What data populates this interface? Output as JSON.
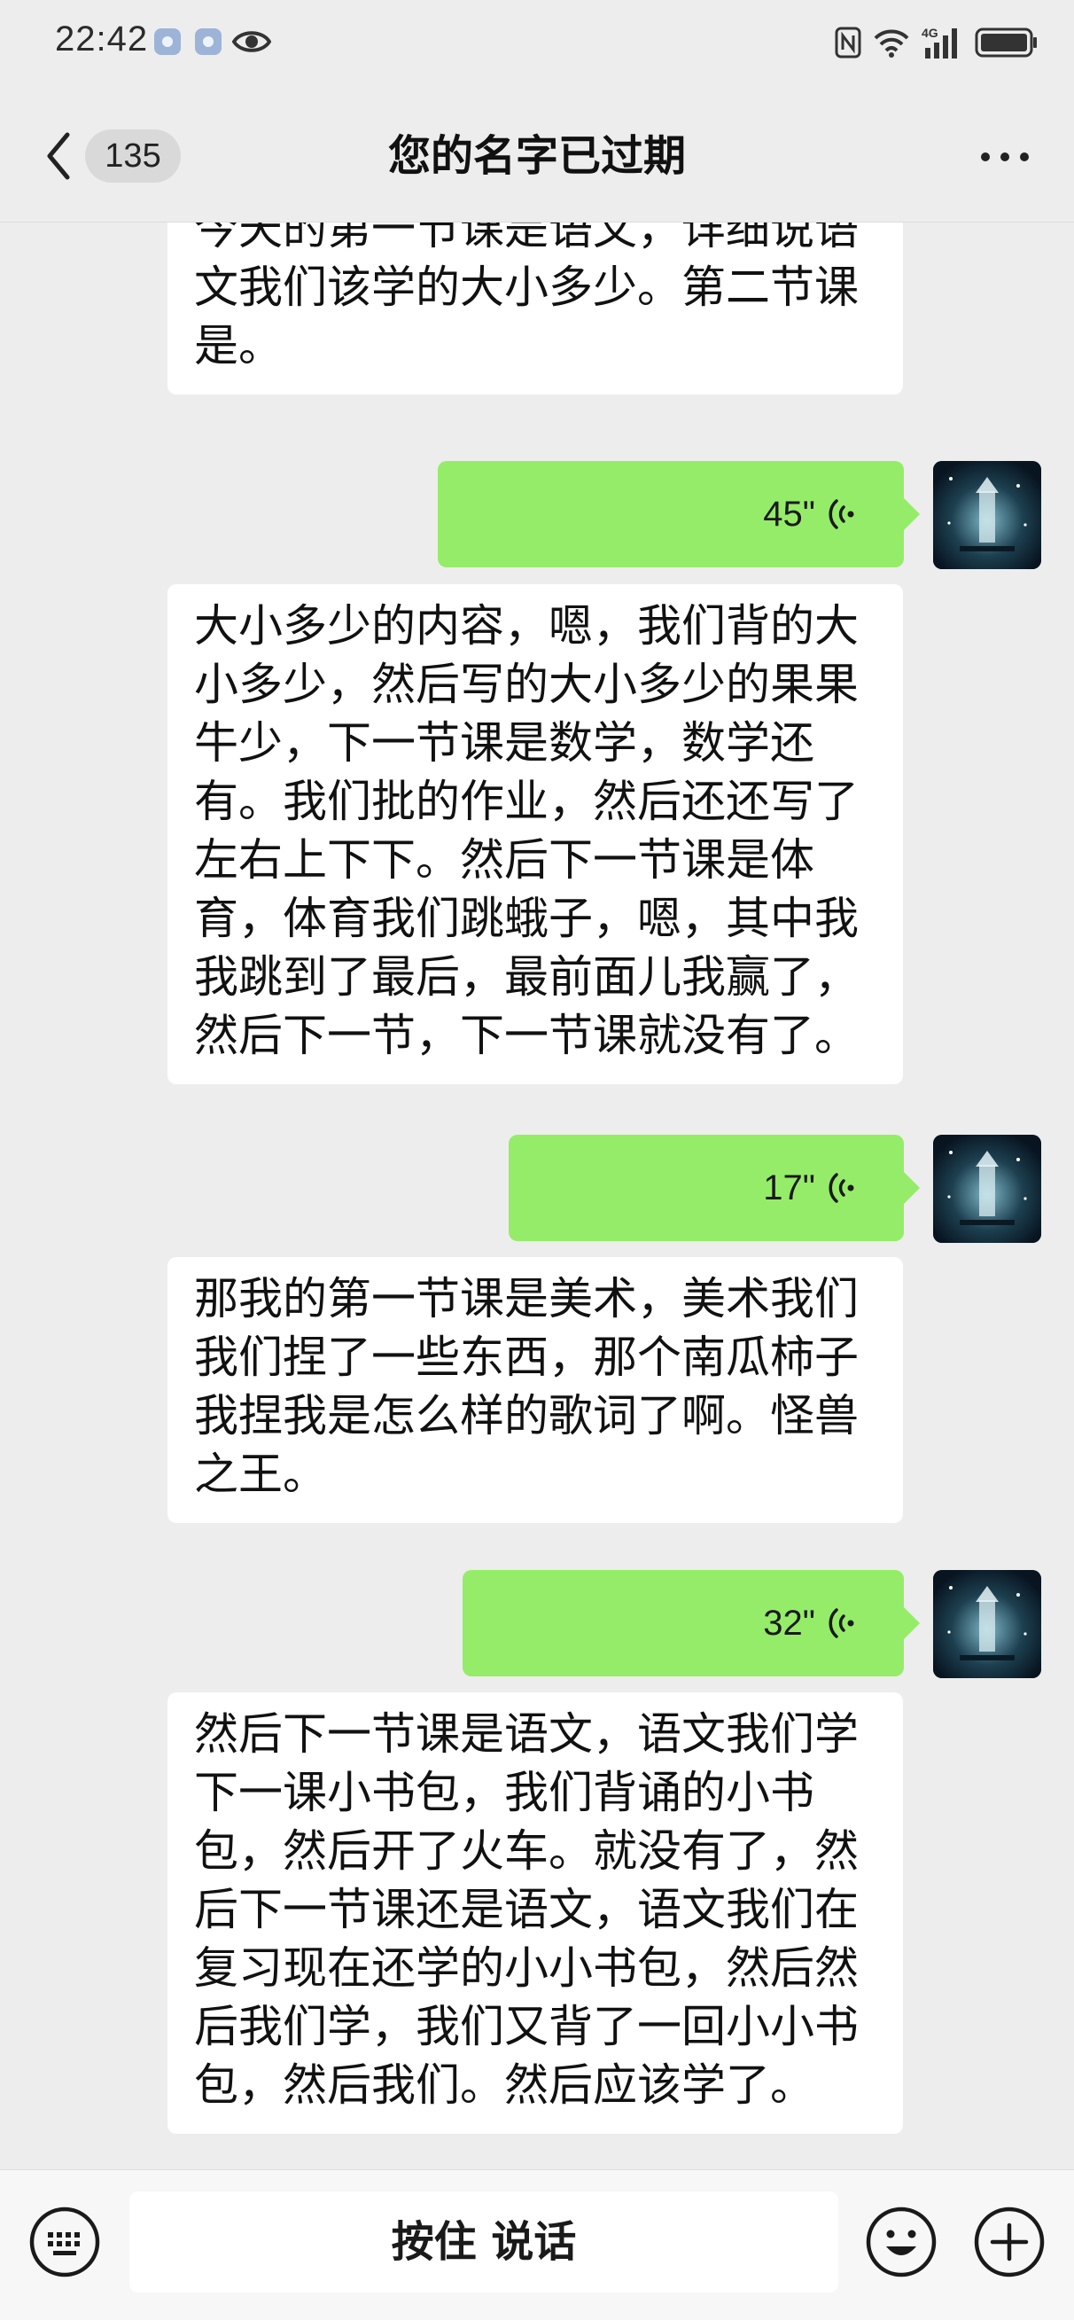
{
  "status_bar": {
    "time": "22:42",
    "network": "4G"
  },
  "header": {
    "unread_count": "135",
    "title": "您的名字已过期"
  },
  "messages": [
    {
      "type": "text",
      "direction": "in",
      "text": "今天的第一节课是语文，详细说语文我们该学的大小多少。第二节课是。"
    },
    {
      "type": "voice",
      "direction": "out",
      "duration": "45\""
    },
    {
      "type": "text",
      "direction": "in",
      "text": "大小多少的内容，嗯，我们背的大小多少，然后写的大小多少的果果牛少，下一节课是数学，数学还有。我们批的作业，然后还还写了左右上下下。然后下一节课是体育，体育我们跳蛾子，嗯，其中我我跳到了最后，最前面儿我赢了，然后下一节，下一节课就没有了。"
    },
    {
      "type": "voice",
      "direction": "out",
      "duration": "17\""
    },
    {
      "type": "text",
      "direction": "in",
      "text": "那我的第一节课是美术，美术我们我们捏了一些东西，那个南瓜柿子我捏我是怎么样的歌词了啊。怪兽之王。"
    },
    {
      "type": "voice",
      "direction": "out",
      "duration": "32\""
    },
    {
      "type": "text",
      "direction": "in",
      "text": "然后下一节课是语文，语文我们学下一课小书包，我们背诵的小书包，然后开了火车。就没有了，然后下一节课还是语文，语文我们在复习现在还学的小小书包，然后然后我们学，我们又背了一回小小书包，然后我们。然后应该学了。"
    }
  ],
  "input_bar": {
    "talk_label": "按住 说话"
  },
  "colors": {
    "background": "#ededed",
    "voice_bubble": "#95ec69",
    "incoming_bubble": "#ffffff"
  }
}
